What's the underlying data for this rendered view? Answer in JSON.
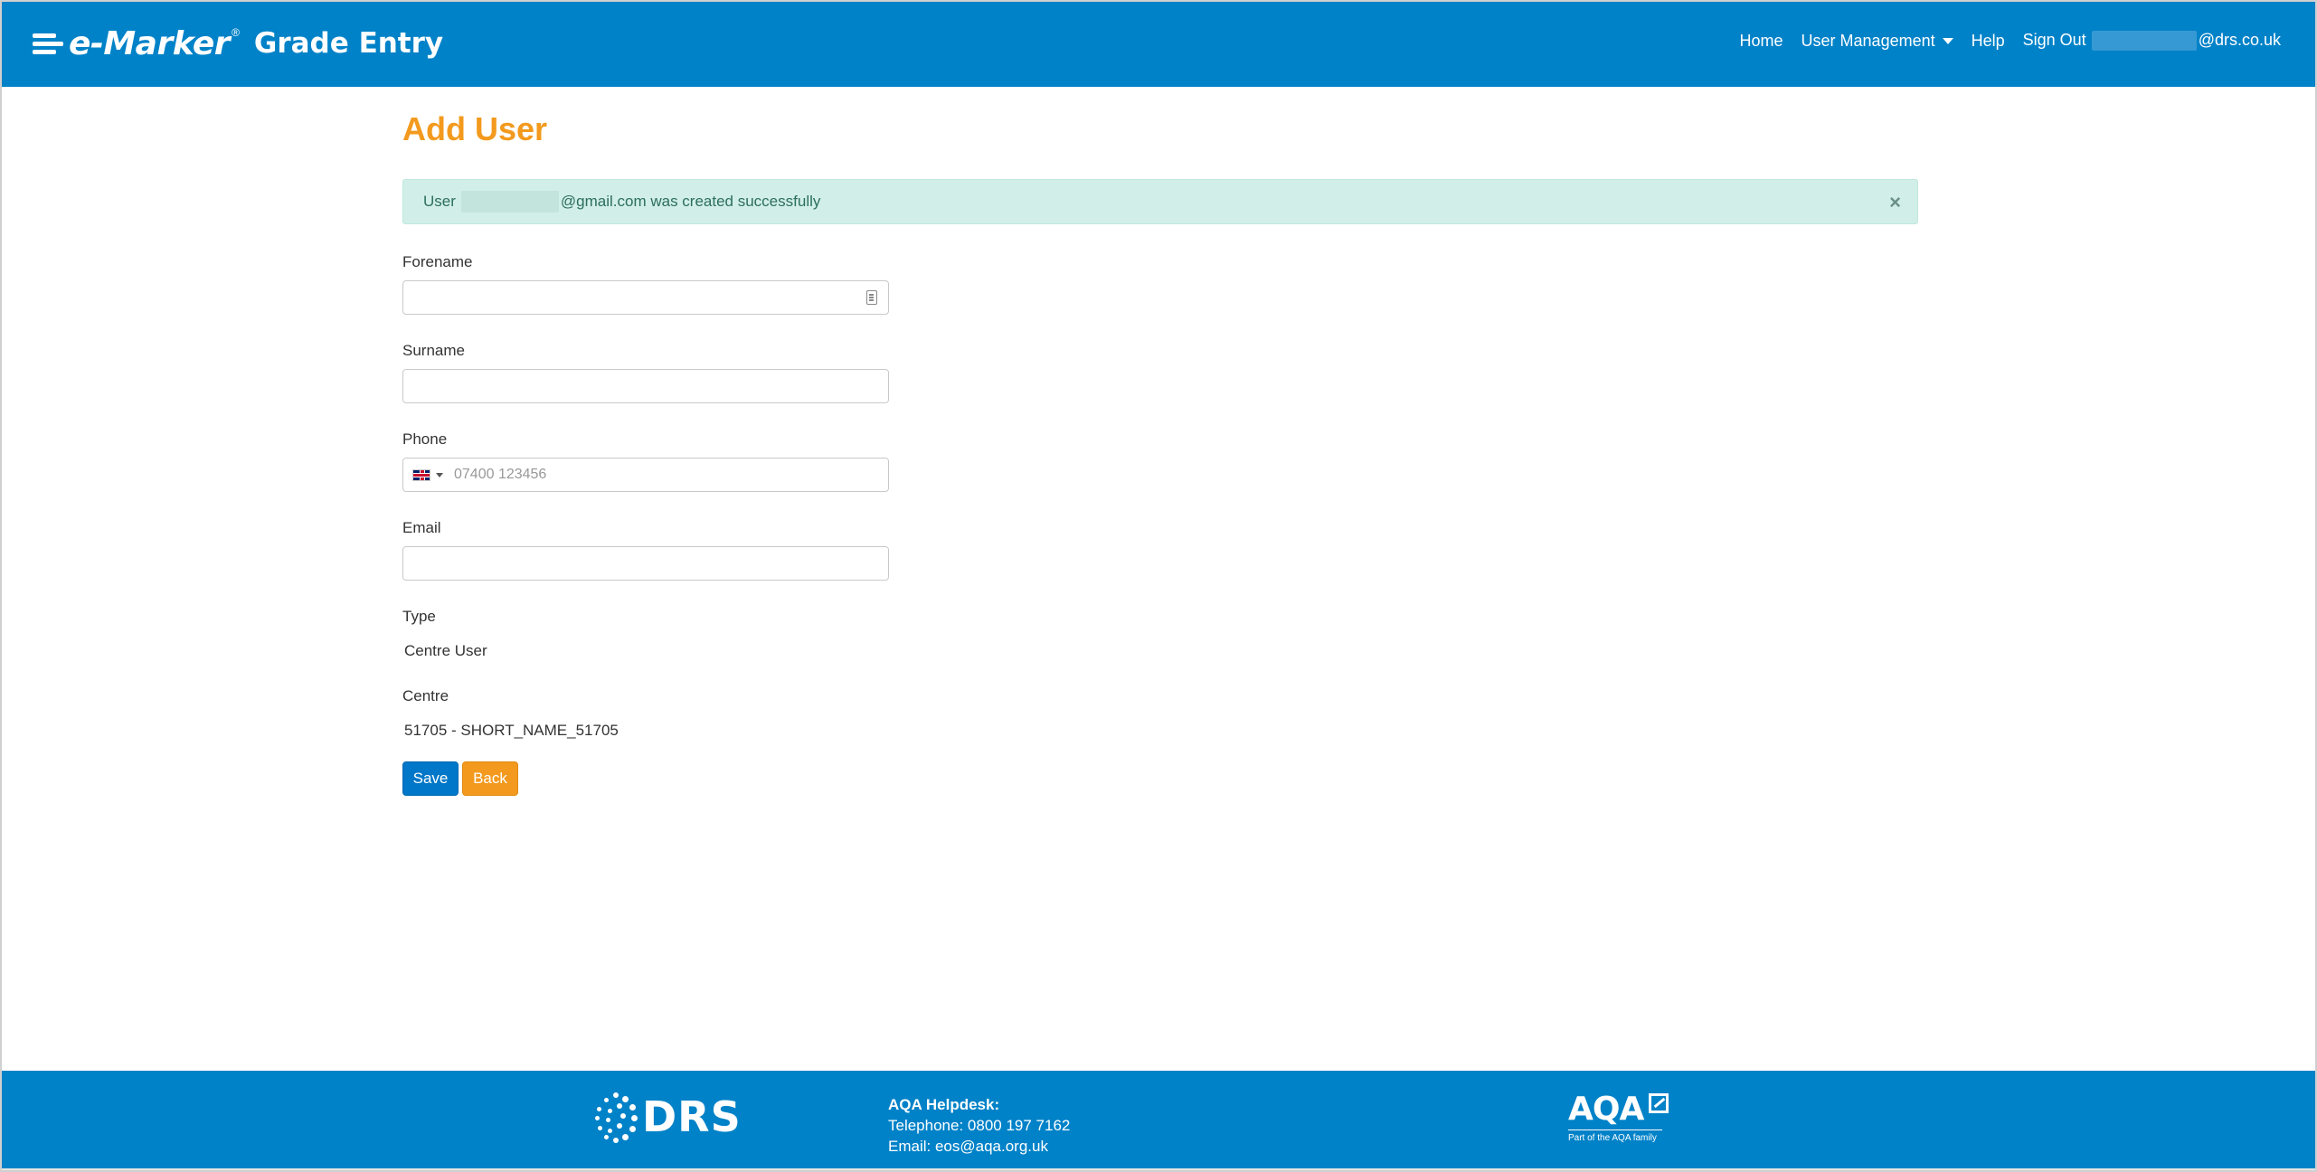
{
  "header": {
    "brand_name": "e-Marker",
    "brand_reg": "®",
    "brand_product": "Grade Entry",
    "nav": {
      "home": "Home",
      "user_management": "User Management",
      "help": "Help",
      "sign_out": "Sign Out",
      "user_email_suffix": "@drs.co.uk"
    },
    "colors": {
      "bar": "#0082c8"
    }
  },
  "main": {
    "title": "Add User",
    "alert": {
      "prefix": "User",
      "email_suffix": "@gmail.com was created successfully",
      "close": "×"
    },
    "form": {
      "forename_label": "Forename",
      "forename_value": "",
      "surname_label": "Surname",
      "surname_value": "",
      "phone_label": "Phone",
      "phone_placeholder": "07400 123456",
      "phone_country_icon": "uk-flag-icon",
      "email_label": "Email",
      "email_value": "",
      "type_label": "Type",
      "type_value": "Centre User",
      "centre_label": "Centre",
      "centre_value": "51705 - SHORT_NAME_51705"
    },
    "buttons": {
      "save": "Save",
      "back": "Back"
    },
    "colors": {
      "title": "#f39a1e",
      "save": "#0077c8",
      "back": "#f39a1e",
      "alert_bg": "#d1efe8"
    }
  },
  "footer": {
    "drs_logo": "DRS",
    "helpdesk_title": "AQA Helpdesk:",
    "telephone": "Telephone: 0800 197 7162",
    "email": "Email: eos@aqa.org.uk",
    "aqa_logo": "AQA",
    "aqa_tagline": "Part of the AQA family"
  }
}
